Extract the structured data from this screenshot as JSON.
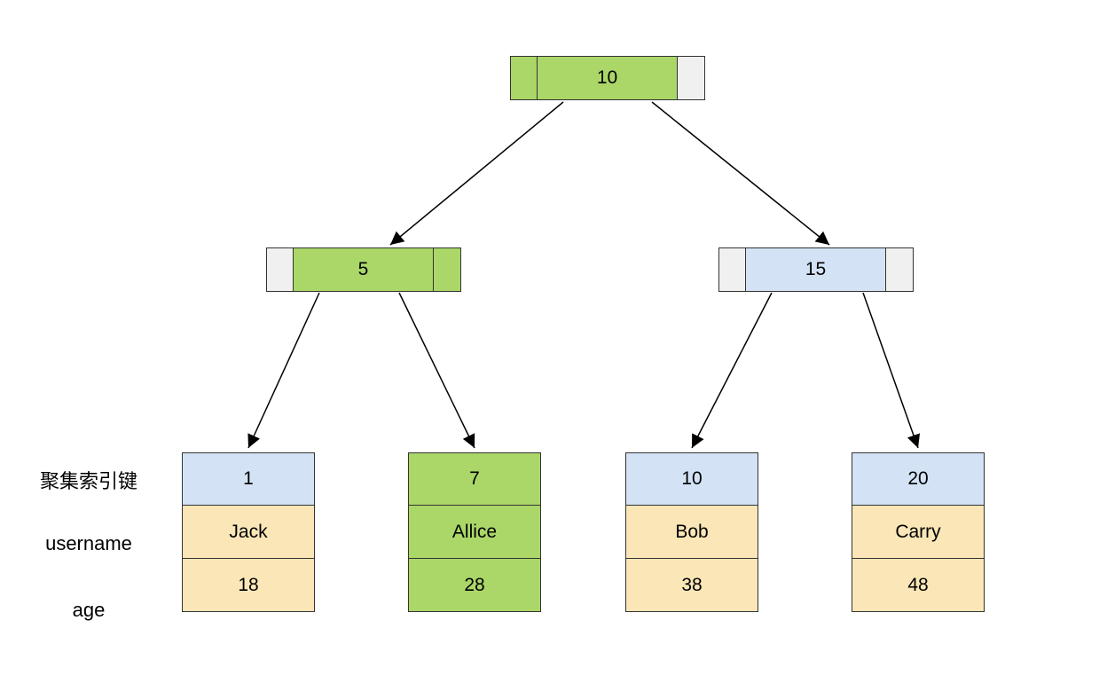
{
  "root": {
    "key": "10"
  },
  "intermediate": {
    "left": {
      "key": "5"
    },
    "right": {
      "key": "15"
    }
  },
  "labels": {
    "clusterKey": "聚集索引键",
    "username": "username",
    "age": "age"
  },
  "leaves": [
    {
      "key": "1",
      "username": "Jack",
      "age": "18"
    },
    {
      "key": "7",
      "username": "Allice",
      "age": "28"
    },
    {
      "key": "10",
      "username": "Bob",
      "age": "38"
    },
    {
      "key": "20",
      "username": "Carry",
      "age": "48"
    }
  ]
}
